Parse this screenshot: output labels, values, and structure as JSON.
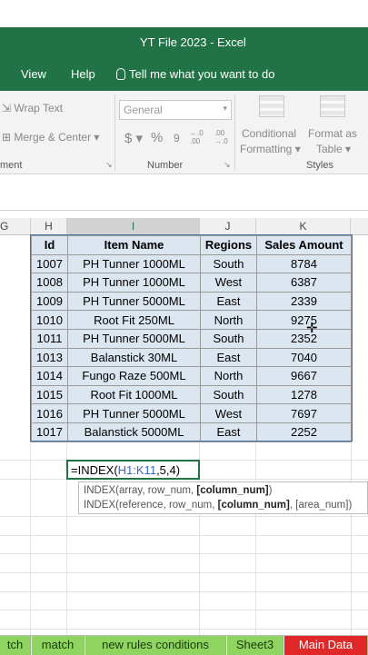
{
  "window": {
    "title": "YT File 2023  -  Excel"
  },
  "menu": {
    "view": "View",
    "help": "Help",
    "tell_me": "Tell me what you want to do"
  },
  "ribbon": {
    "wrap_text": "Wrap Text",
    "merge_center": "Merge & Center",
    "alignment_group": "ment",
    "number_format": "General",
    "currency": "$",
    "percent": "%",
    "comma": "9",
    "inc_decimal": "←.0 .00",
    "dec_decimal": ".00 →.0",
    "number_group": "Number",
    "conditional_1": "Conditional",
    "conditional_2": "Formatting",
    "format_as_1": "Format as",
    "format_as_2": "Table",
    "styles_group": "Styles"
  },
  "columns": [
    "G",
    "H",
    "I",
    "J",
    "K"
  ],
  "table": {
    "headers": [
      "Id",
      "Item Name",
      "Regions",
      "Sales Amount"
    ],
    "rows": [
      [
        "1007",
        "PH Tunner 1000ML",
        "South",
        "8784"
      ],
      [
        "1008",
        "PH Tunner 1000ML",
        "West",
        "6387"
      ],
      [
        "1009",
        "PH Tunner 5000ML",
        "East",
        "2339"
      ],
      [
        "1010",
        "Root Fit 250ML",
        "North",
        "9275"
      ],
      [
        "1011",
        "PH Tunner 5000ML",
        "South",
        "2352"
      ],
      [
        "1013",
        "Balanstick 30ML",
        "East",
        "7040"
      ],
      [
        "1014",
        "Fungo Raze 500ML",
        "North",
        "9667"
      ],
      [
        "1015",
        "Root Fit 1000ML",
        "South",
        "1278"
      ],
      [
        "1016",
        "PH Tunner 5000ML",
        "West",
        "7697"
      ],
      [
        "1017",
        "Balanstick 5000ML",
        "East",
        "2252"
      ]
    ]
  },
  "formula": {
    "prefix": "=INDEX(",
    "ref": "H1:K11",
    "suffix": ",5,4)"
  },
  "tooltip": {
    "line1_pre": "INDEX(array, row_num, ",
    "line1_bold": "[column_num]",
    "line1_post": ")",
    "line2_pre": "INDEX(reference, row_num, ",
    "line2_bold": "[column_num]",
    "line2_post": ", [area_num])"
  },
  "sheets": [
    "tch",
    "match",
    "new rules conditions",
    "Sheet3",
    "Main Data"
  ],
  "colors": {
    "excel_green": "#217346",
    "table_fill": "#dce6f1",
    "tab_green": "#8fd460",
    "tab_red": "#e02828"
  }
}
